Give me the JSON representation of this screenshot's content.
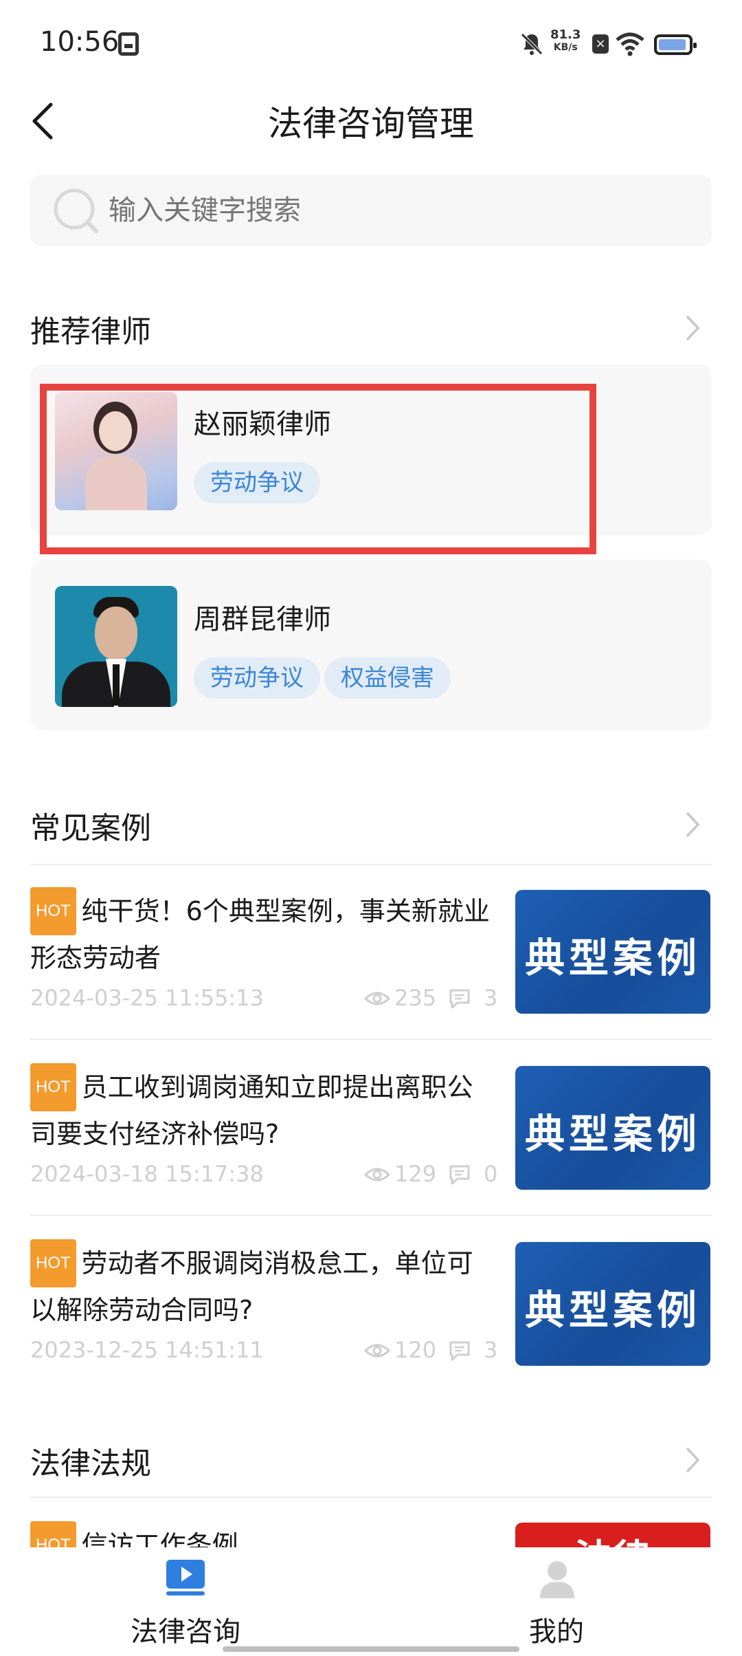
{
  "status_bar": {
    "time": "10:56",
    "net_speed_value": "81.3",
    "net_speed_unit": "KB/s",
    "battery_level": 0.82
  },
  "header": {
    "title": "法律咨询管理"
  },
  "search": {
    "placeholder": "输入关键字搜索"
  },
  "sections": {
    "lawyers": {
      "title": "推荐律师"
    },
    "cases": {
      "title": "常见案例"
    },
    "laws": {
      "title": "法律法规"
    }
  },
  "lawyers": [
    {
      "name": "赵丽颖律师",
      "tags": [
        "劳动争议"
      ]
    },
    {
      "name": "周群昆律师",
      "tags": [
        "劳动争议",
        "权益侵害"
      ]
    }
  ],
  "hot_badge": "HOT",
  "cases": [
    {
      "title": "纯干货！6个典型案例，事关新就业形态劳动者",
      "date": "2024-03-25 11:55:13",
      "views": "235",
      "comments": "3",
      "thumb_text": "典型案例"
    },
    {
      "title": "员工收到调岗通知立即提出离职公司要支付经济补偿吗?",
      "date": "2024-03-18 15:17:38",
      "views": "129",
      "comments": "0",
      "thumb_text": "典型案例"
    },
    {
      "title": "劳动者不服调岗消极怠工，单位可以解除劳动合同吗?",
      "date": "2023-12-25 14:51:11",
      "views": "120",
      "comments": "3",
      "thumb_text": "典型案例"
    }
  ],
  "laws": [
    {
      "title": "信访工作条例",
      "thumb_text": "法律"
    }
  ],
  "bottom_nav": {
    "consult": "法律咨询",
    "mine": "我的"
  },
  "colors": {
    "accent": "#3a86d6",
    "tag_bg": "#e2ecf7",
    "hot": "#f39b2d",
    "highlight": "#e8443f",
    "thumb": "#1e5fb3"
  }
}
